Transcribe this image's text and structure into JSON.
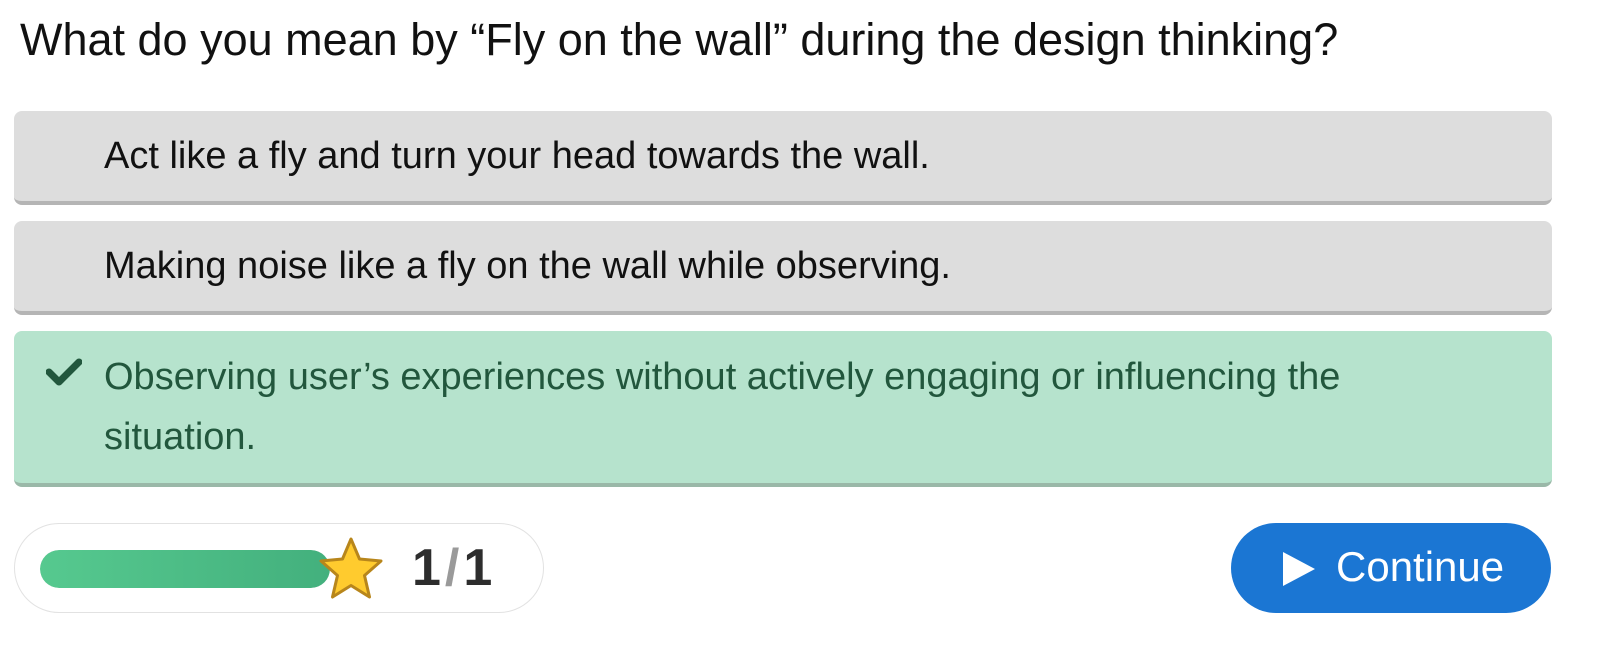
{
  "question": {
    "text": "What do you mean by “Fly on the wall” during the design thinking?"
  },
  "options": [
    {
      "text": "Act like a fly and turn your head towards the wall.",
      "state": "unselected"
    },
    {
      "text": "Making noise like a fly on the wall while observing.",
      "state": "unselected"
    },
    {
      "text": "Observing user’s experiences without actively engaging or influencing the situation.",
      "state": "correct",
      "icon": "checkmark-icon"
    }
  ],
  "progress": {
    "fraction_complete": 1.0,
    "current": "1",
    "separator": "/",
    "total": "1",
    "icon": "star-icon"
  },
  "continue_button": {
    "label": "Continue",
    "icon": "play-icon"
  },
  "colors": {
    "option_neutral": "#dddddd",
    "option_correct": "#b6e3cd",
    "correct_text": "#22573d",
    "progress_fill": "#4fbf87",
    "button": "#1b76d3",
    "star": "#ffcb2e"
  }
}
